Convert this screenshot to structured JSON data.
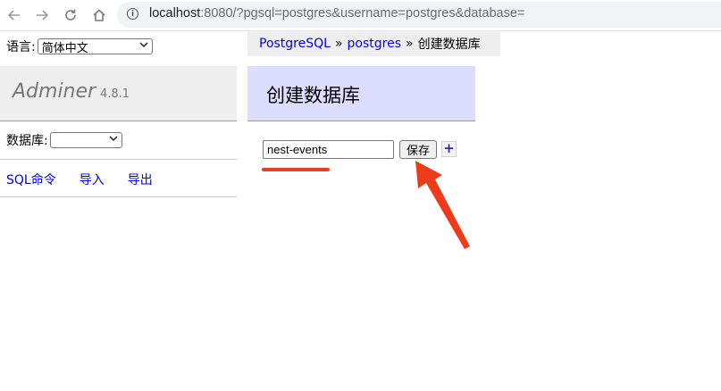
{
  "browser": {
    "url_host": "localhost",
    "url_rest": ":8080/?pgsql=postgres&username=postgres&database=",
    "info_icon_glyph": "i"
  },
  "sidebar": {
    "language_label": "语言:",
    "language_value": "简体中文",
    "app_name": "Adminer",
    "app_version": "4.8.1",
    "database_label": "数据库:",
    "database_value": "",
    "links": [
      "SQL命令",
      "导入",
      "导出"
    ]
  },
  "breadcrumb": {
    "items": [
      "PostgreSQL",
      "postgres"
    ],
    "separator": "»",
    "current": "创建数据库"
  },
  "main": {
    "heading": "创建数据库",
    "db_name_value": "nest-events",
    "save_label": "保存",
    "add_label": "+"
  },
  "annotations": {
    "color": "#ee3b1a",
    "arrow_icon": "arrow-pointing-to-save-button",
    "underline_icon": "underline-under-input"
  }
}
